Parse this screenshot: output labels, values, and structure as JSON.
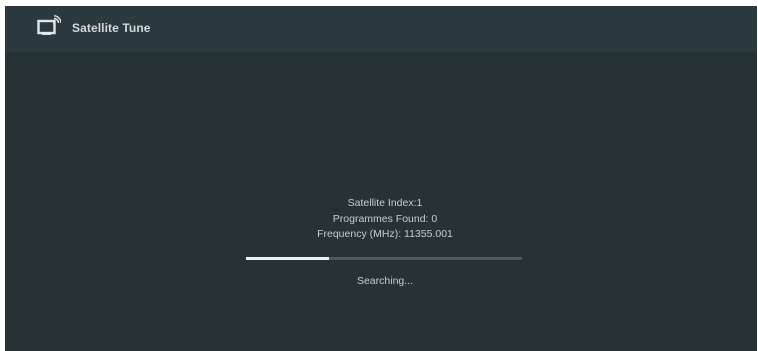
{
  "header": {
    "title": "Satellite Tune",
    "icon": "tv-antenna-icon"
  },
  "scan": {
    "satellite_index": "Satellite Index:1",
    "programmes_found": "Programmes Found: 0",
    "frequency": "Frequency (MHz): 11355.001",
    "progress_fraction": 0.3,
    "status": "Searching..."
  },
  "colors": {
    "background": "#263236",
    "header_background": "#2c393e",
    "text": "#c7cdd0",
    "progress_fill": "#eef1f2",
    "progress_track": "#4d595e"
  }
}
